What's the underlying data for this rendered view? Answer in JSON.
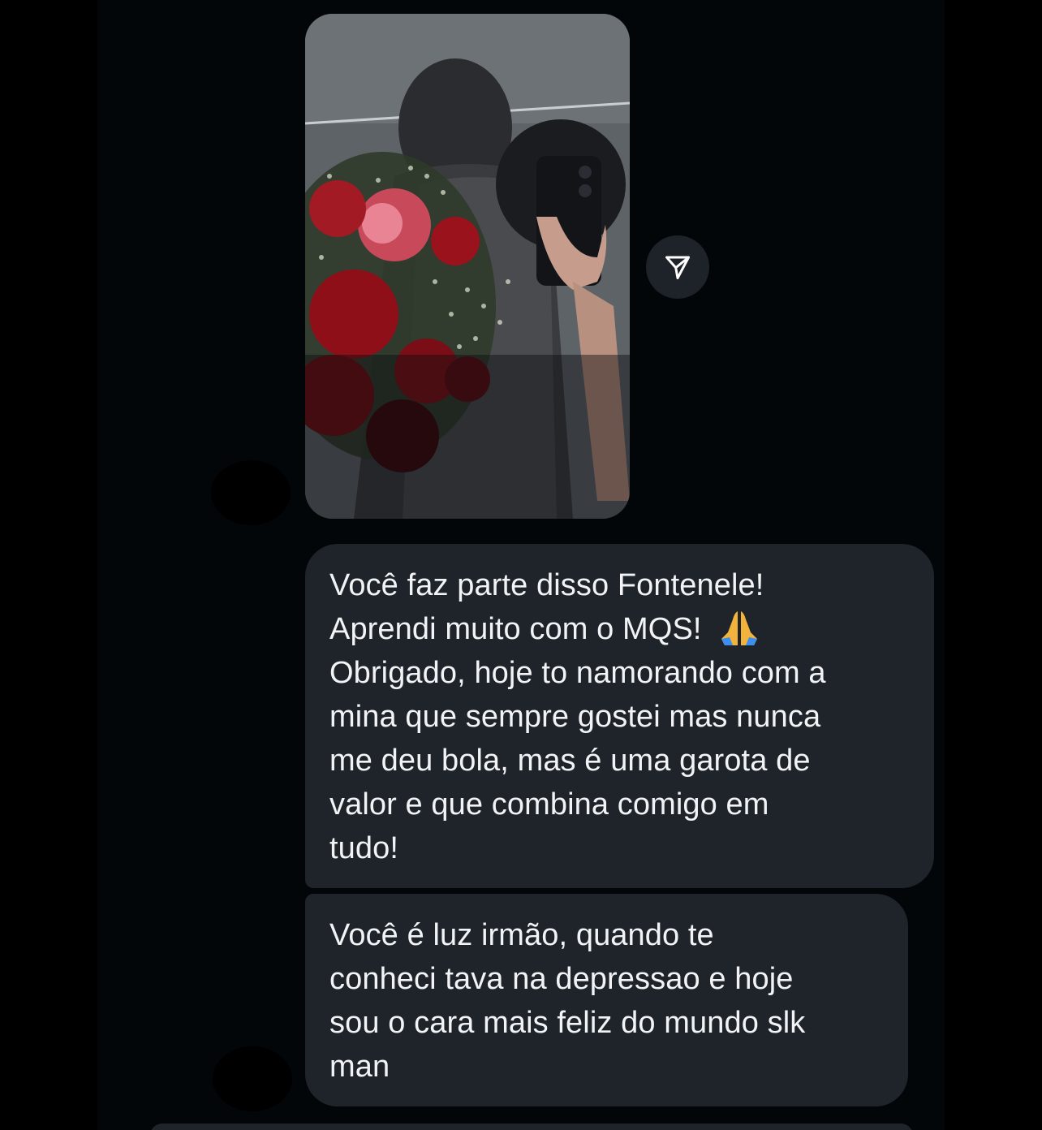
{
  "messages": [
    {
      "type": "story_reply_image",
      "image_alt": "Story photo: couple with red roses bouquet in mirror selfie",
      "share_icon": "paper-plane-icon"
    },
    {
      "type": "text",
      "lines": [
        "Você faz parte disso Fontenele!",
        "Aprendi muito com o MQS! ",
        "Obrigado, hoje to namorando com a",
        "mina que sempre gostei mas nunca",
        "me deu bola, mas é uma garota de",
        "valor e que combina comigo em",
        "tudo!"
      ],
      "emoji": "folded-hands-emoji"
    },
    {
      "type": "text",
      "lines": [
        "Você é luz irmão, quando te",
        "conheci tava na depressao e hoje",
        "sou o cara mais feliz do mundo slk",
        "man"
      ]
    }
  ],
  "colors": {
    "background": "#000000",
    "chat_background": "#030609",
    "bubble": "#1f242b",
    "text": "#f1f3f5",
    "share_button": "#1e2329"
  }
}
